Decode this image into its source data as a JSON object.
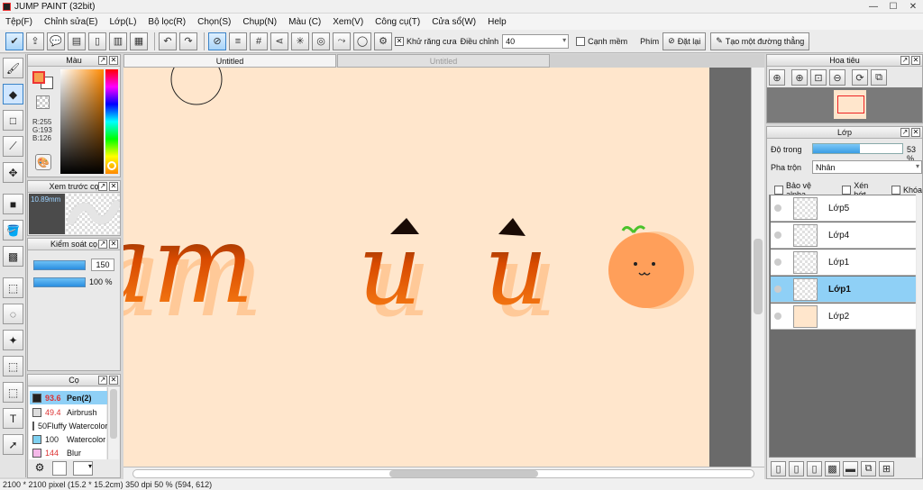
{
  "window": {
    "title": "JUMP PAINT (32bit)",
    "min": "—",
    "max": "☐",
    "close": "✕"
  },
  "menu": [
    "Tệp(F)",
    "Chỉnh sửa(E)",
    "Lớp(L)",
    "Bộ lọc(R)",
    "Chọn(S)",
    "Chụp(N)",
    "Màu (C)",
    "Xem(V)",
    "Công cụ(T)",
    "Cửa sổ(W)",
    "Help"
  ],
  "toolbar": {
    "antialias_label": "Khử răng cưa",
    "adjust_label": "Điều chỉnh",
    "adjust_value": "40",
    "soft_edge_label": "Cạnh mềm",
    "key_label": "Phím",
    "reset_label": "Đặt lại",
    "line_label": "Tạo một đường thẳng"
  },
  "color_panel": {
    "title": "Màu",
    "r": "R:255",
    "g": "G:193",
    "b": "B:126",
    "fg": "#f5a050",
    "bg": "#ffffff"
  },
  "brush_preview": {
    "title": "Xem trước cọ",
    "size": "10.89mm"
  },
  "brush_control": {
    "title": "Kiểm soát cọ",
    "size": "150",
    "opacity": "100 %"
  },
  "brush_panel": {
    "title": "Cọ",
    "items": [
      {
        "size": "93.6",
        "name": "Pen(2)",
        "color": "#222222"
      },
      {
        "size": "49.4",
        "name": "Airbrush",
        "color": "#dddddd"
      },
      {
        "size": "50",
        "name": "Fluffy Watercolor",
        "color": "#c8e88a"
      },
      {
        "size": "100",
        "name": "Watercolor",
        "color": "#7ed0f0"
      },
      {
        "size": "144",
        "name": "Blur",
        "color": "#f4b8e8"
      }
    ]
  },
  "tabs": [
    "Untitled",
    "Untitled"
  ],
  "canvas": {
    "bg": "#ffe6cc",
    "text": "ạm ủ ủ"
  },
  "navigator": {
    "title": "Hoa tiêu"
  },
  "layers_panel": {
    "title": "Lớp",
    "opacity_label": "Độ trong",
    "opacity_value": 53,
    "opacity_text": "53 %",
    "blend_label": "Pha trộn",
    "blend_value": "Nhân",
    "protect_alpha": "Bảo vệ alpha",
    "clip": "Xén bớt",
    "lock": "Khóa",
    "layers": [
      {
        "name": "Lớp5",
        "selected": false
      },
      {
        "name": "Lớp4",
        "selected": false
      },
      {
        "name": "Lớp1",
        "selected": false
      },
      {
        "name": "Lớp1",
        "selected": true
      },
      {
        "name": "Lớp2",
        "selected": false
      }
    ]
  },
  "status": {
    "text": "2100 * 2100 pixel  (15.2 * 15.2cm)  350 dpi  50 %  (594, 612)"
  }
}
